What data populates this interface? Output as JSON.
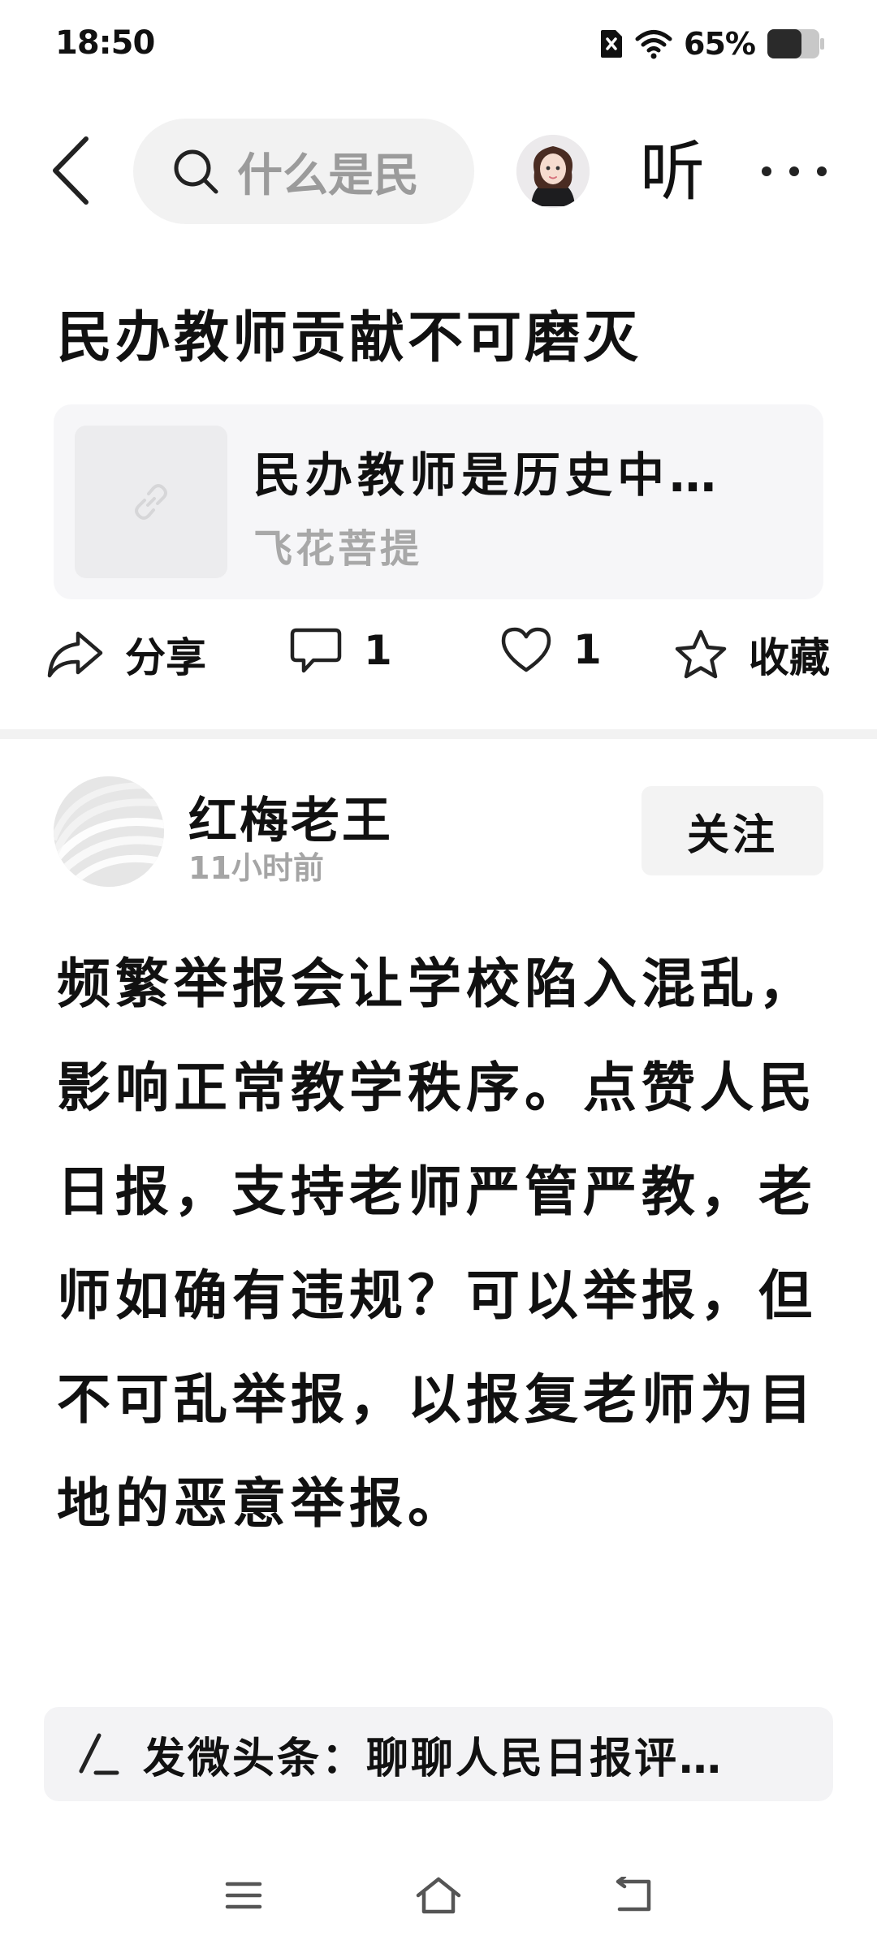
{
  "status_bar": {
    "time": "18:50",
    "battery_percent": "65%",
    "battery_level": 0.65
  },
  "header": {
    "search_text": "什么是民",
    "listen_label": "听"
  },
  "article": {
    "title": "民办教师贡献不可磨灭",
    "link_card": {
      "title": "民办教师是历史中…",
      "author": "飞花菩提"
    },
    "actions": {
      "share_label": "分享",
      "comment_count": "1",
      "like_count": "1",
      "favorite_label": "收藏"
    }
  },
  "post": {
    "username": "红梅老王",
    "time": "11小时前",
    "follow_label": "关注",
    "body": "频繁举报会让学校陷入混乱，影响正常教学秩序。点赞人民日报，支持老师严管严教，老师如确有违规？可以举报，但不可乱举报，以报复老师为目地的恶意举报。"
  },
  "compose": {
    "text": "发微头条：聊聊人民日报评…"
  },
  "icons": {
    "back": "chevron-left-icon",
    "search": "search-icon",
    "share": "share-icon",
    "comment": "comment-icon",
    "like": "heart-icon",
    "favorite": "star-icon",
    "link": "link-icon",
    "compose": "pen-icon"
  }
}
